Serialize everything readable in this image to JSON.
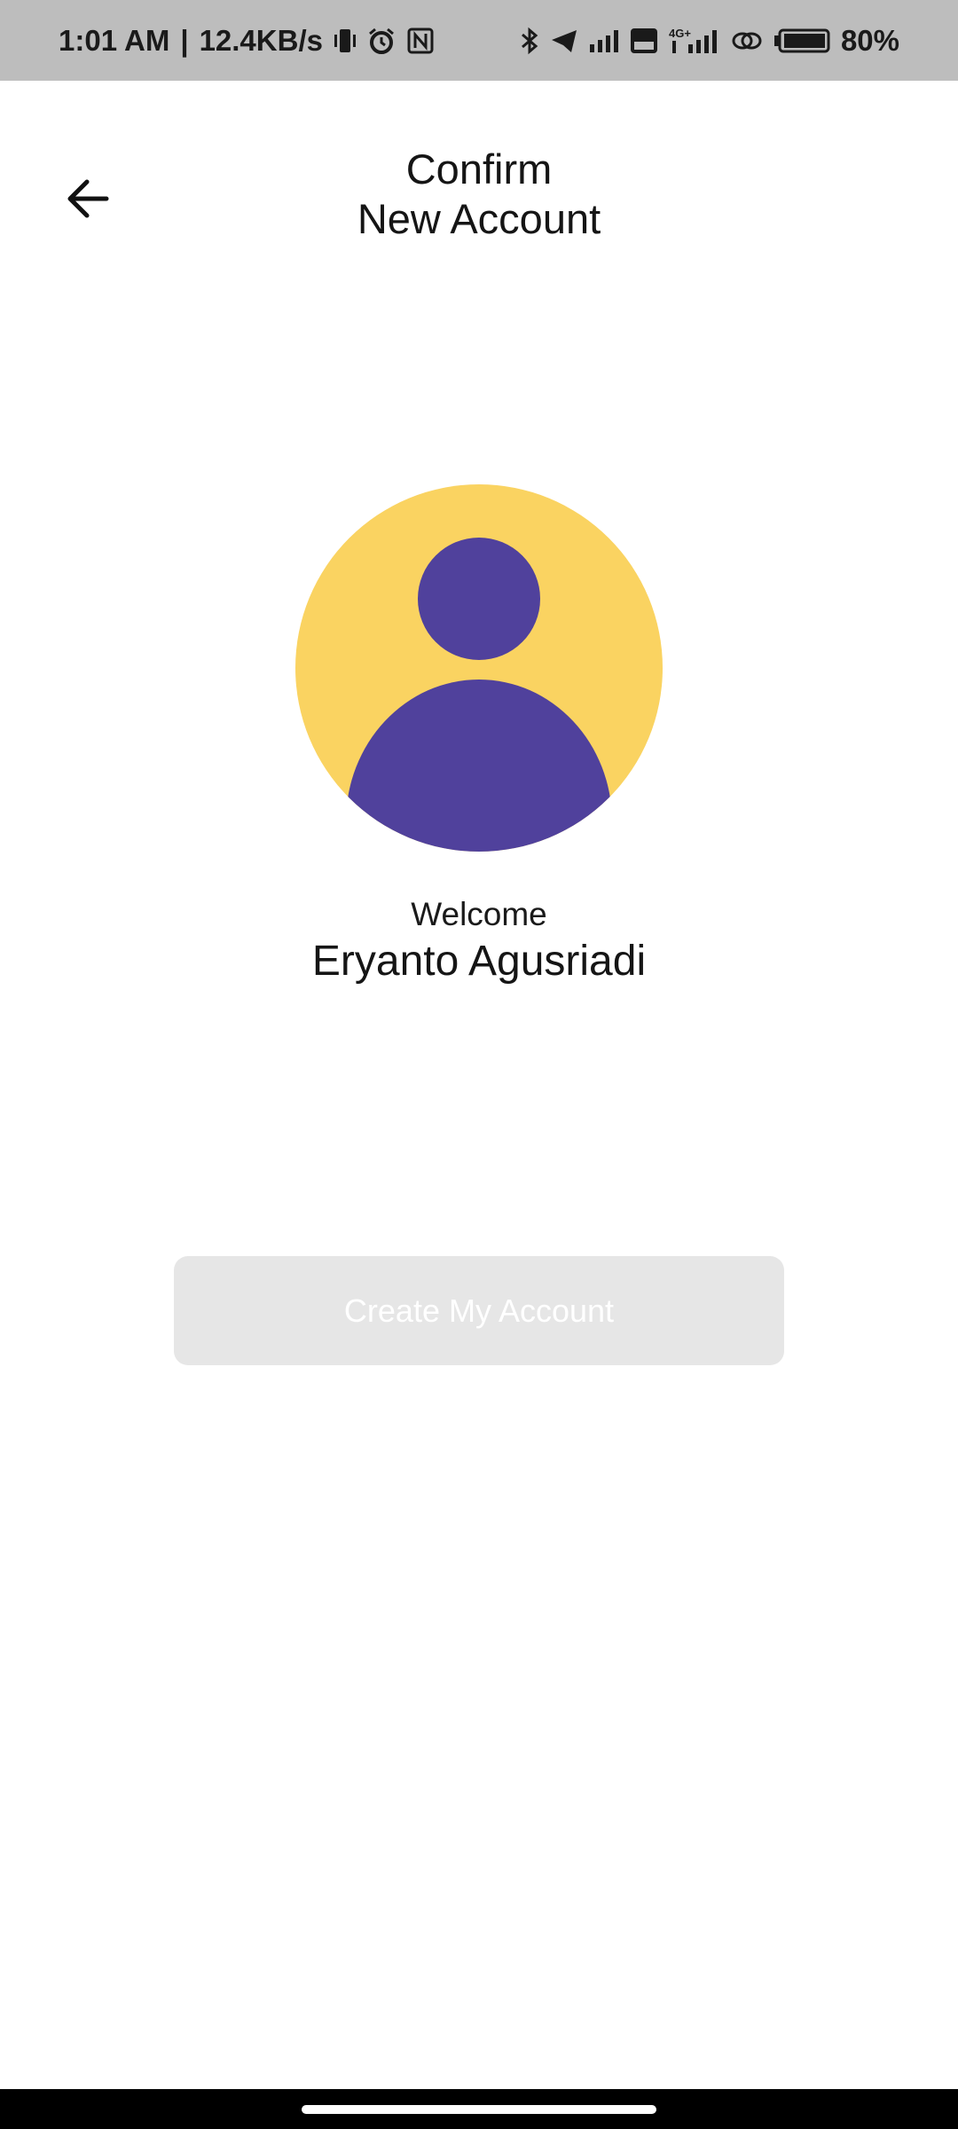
{
  "status_bar": {
    "time": "1:01 AM",
    "separator": "|",
    "network_speed": "12.4KB/s",
    "battery": "80%",
    "icons": [
      "vibrate-icon",
      "alarm-icon",
      "nfc-icon",
      "bluetooth-icon",
      "telegram-icon",
      "signal-icon",
      "volte-icon",
      "4g-signal-icon",
      "link-icon",
      "battery-icon"
    ]
  },
  "header": {
    "title_line1": "Confirm",
    "title_line2": "New Account",
    "back_icon": "arrow-left-icon"
  },
  "profile": {
    "avatar_icon": "user-avatar-icon",
    "avatar_bg_color": "#fad361",
    "avatar_fg_color": "#50419c",
    "welcome": "Welcome",
    "name": "Eryanto Agusriadi"
  },
  "actions": {
    "create_label": "Create My Account",
    "disabled": true
  }
}
